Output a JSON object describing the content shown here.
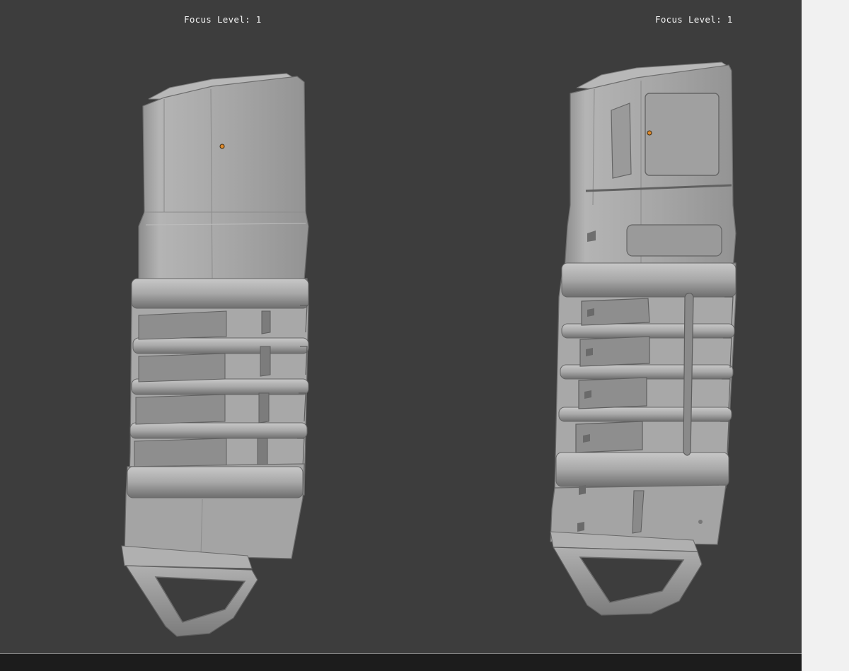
{
  "viewports": {
    "left": {
      "focus_label": "Focus Level: 1"
    },
    "right": {
      "focus_label": "Focus Level: 1"
    }
  },
  "colors": {
    "background": "#3d3d3d",
    "model_base": "#a2a2a2",
    "model_highlight": "#c4c4c4",
    "model_shadow": "#7a7a7a",
    "pivot_point": "#e08a2c",
    "bottom_bar": "#1c1c1c",
    "right_panel": "#f1f1f1"
  }
}
